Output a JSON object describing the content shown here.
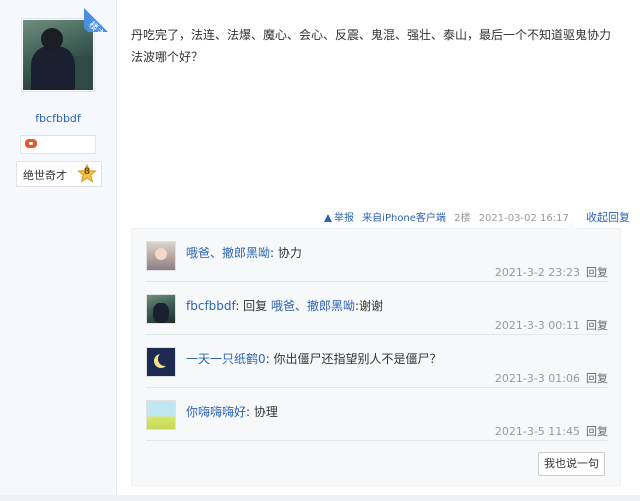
{
  "author": {
    "username": "fbcfbbdf",
    "louzhu_label": "楼主",
    "level_title": "绝世奇才",
    "level_number": "8"
  },
  "post": {
    "text": "丹吃完了，法连、法爆、魔心、会心、反震、鬼混、强壮、泰山，最后一个不知道驱鬼协力法波哪个好？",
    "report_label": "举报",
    "client_label": "来自iPhone客户端",
    "floor": "2楼",
    "datetime": "2021-03-02 16:17",
    "collapse_label": "收起回复"
  },
  "replies": [
    {
      "name": "哦爸、撤郎黑呦",
      "text": ": 协力",
      "reply_to": "",
      "time": "2021-3-2 23:23",
      "reply_label": "回复"
    },
    {
      "name": "fbcfbbdf",
      "text": ":谢谢",
      "reply_prefix": ": 回复 ",
      "reply_to": "哦爸、撤郎黑呦",
      "time": "2021-3-3 00:11",
      "reply_label": "回复"
    },
    {
      "name": "一天一只纸鹤0",
      "text": ": 你出僵尸还指望别人不是僵尸？",
      "reply_to": "",
      "time": "2021-3-3 01:06",
      "reply_label": "回复"
    },
    {
      "name": "你嗨嗨嗨好",
      "text": ": 协理",
      "reply_to": "",
      "time": "2021-3-5 11:45",
      "reply_label": "回复"
    }
  ],
  "say_button": "我也说一句",
  "colors": {
    "link": "#2d64b3",
    "badge_blue": "#4a8fe0",
    "sidebar_bg": "#f5f8fd"
  }
}
